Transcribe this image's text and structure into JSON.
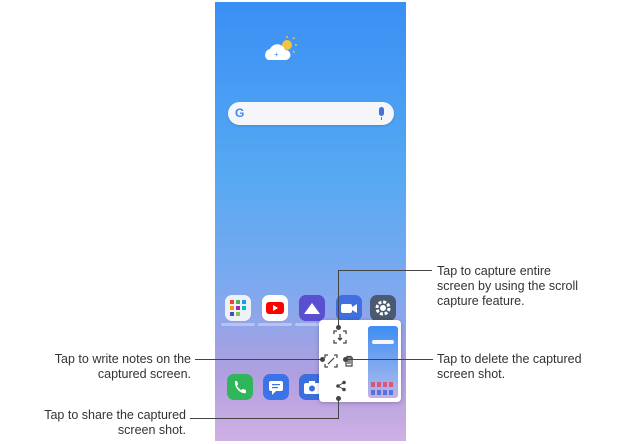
{
  "annotations": {
    "capture_entire": [
      "Tap to capture entire",
      "screen by using the scroll",
      "capture feature."
    ],
    "write_notes": [
      "Tap to write notes on the",
      "captured screen."
    ],
    "delete": [
      "Tap to delete the captured",
      "screen shot."
    ],
    "share": [
      "Tap to share the captured",
      "screen shot."
    ]
  },
  "search": {
    "logo": "G"
  },
  "colors": {
    "callout_text": "#333333",
    "leader_line": "#444444"
  },
  "icons": [
    "weather-icon",
    "google-logo-icon",
    "mic-icon",
    "scroll-capture-icon",
    "edit-icon",
    "trash-icon",
    "share-icon"
  ]
}
